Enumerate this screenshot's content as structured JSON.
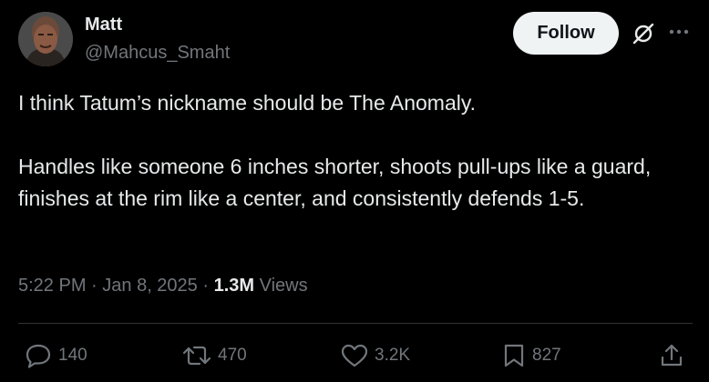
{
  "author": {
    "name": "Matt",
    "handle": "@Mahcus_Smaht"
  },
  "header": {
    "follow_label": "Follow",
    "grok_icon": "grok-icon",
    "more_icon": "more-icon"
  },
  "tweet": {
    "paragraphs": [
      "I think Tatum’s nickname should be The Anomaly.",
      "Handles like someone 6 inches shorter, shoots pull-ups like a guard, finishes at the rim like a center, and consistently defends 1-5."
    ]
  },
  "meta": {
    "time": "5:22 PM",
    "separator": " · ",
    "date": "Jan 8, 2025",
    "views_count": "1.3M",
    "views_label": " Views"
  },
  "actions": {
    "replies": "140",
    "reposts": "470",
    "likes": "3.2K",
    "bookmarks": "827"
  },
  "colors": {
    "background": "#000000",
    "text_primary": "#e7e9ea",
    "text_secondary": "#71767b",
    "follow_button_bg": "#eff3f4",
    "divider": "#2f3336"
  }
}
